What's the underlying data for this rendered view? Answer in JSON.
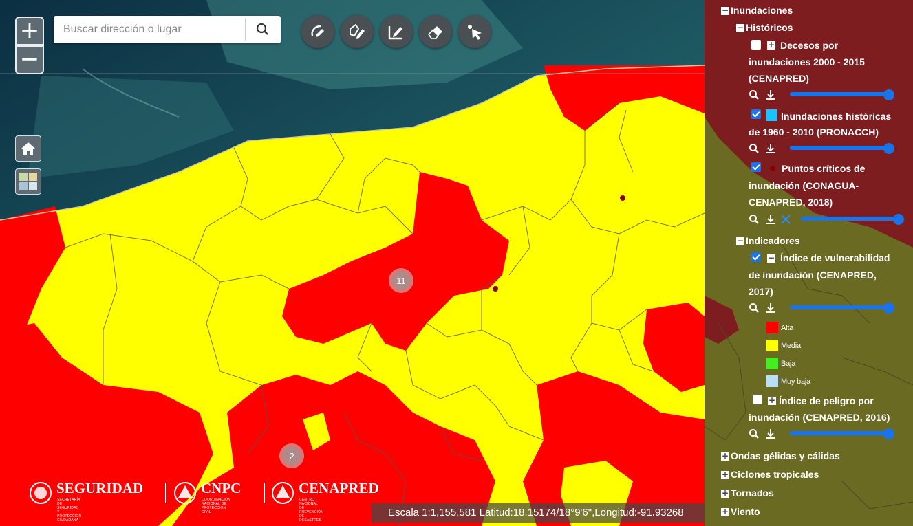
{
  "search": {
    "placeholder": "Buscar dirección o lugar"
  },
  "zoom": {
    "in": "+",
    "out": "−"
  },
  "toolbar": {
    "tools": [
      {
        "name": "draw-line-icon"
      },
      {
        "name": "draw-polygon-icon"
      },
      {
        "name": "edit-icon"
      },
      {
        "name": "eraser-icon"
      },
      {
        "name": "select-cursor-icon"
      }
    ]
  },
  "map": {
    "clusters": [
      {
        "count": "11"
      },
      {
        "count": "2"
      }
    ],
    "colors": {
      "alta": "#ff0000",
      "media": "#ffff00",
      "sea": "#143c4f",
      "boundary": "#555555"
    }
  },
  "logos": {
    "seguridad": "SEGURIDAD",
    "seguridad_sub": "SECRETARÍA DE SEGURIDAD Y PROTECCIÓN CIUDADANA",
    "cnpc": "CNPC",
    "cnpc_sub": "COORDINACIÓN NACIONAL DE PROTECCIÓN CIVIL",
    "cenapred": "CENAPRED",
    "cenapred_sub": "CENTRO NACIONAL DE PREVENCIÓN DE DESASTRES"
  },
  "status": {
    "text": "Escala 1:1,155,581 Latitud:18.15174/18°9'6\",Longitud:-91.93268"
  },
  "panel": {
    "inundaciones": "Inundaciones",
    "historicos": "Históricos",
    "decesos": [
      "Decesos por",
      "inundaciones 2000 - 2015",
      "(CENAPRED)"
    ],
    "historicas": [
      "Inundaciones históricas",
      "de 1960 - 2010 (PRONACCH)"
    ],
    "puntos": [
      "Puntos críticos de",
      "inundación (CONAGUA-",
      "CENAPRED, 2018)"
    ],
    "indicadores": "Indicadores",
    "vulnerabilidad": [
      "Índice de vulnerabilidad",
      "de inundación (CENAPRED,",
      "2017)"
    ],
    "legend": [
      {
        "label": "Alta",
        "color": "#ff0000"
      },
      {
        "label": "Media",
        "color": "#ffff00"
      },
      {
        "label": "Baja",
        "color": "#44ee22"
      },
      {
        "label": "Muy baja",
        "color": "#b8e0f4"
      }
    ],
    "peligro": [
      "Índice de peligro por",
      "inundación (CENAPRED, 2016)"
    ],
    "groups": [
      "Ondas gélidas y cálidas",
      "Ciclones tropicales",
      "Tornados",
      "Viento"
    ],
    "layer_colors": {
      "historicas": "#19c3ff",
      "puntos": "#8b0000"
    }
  }
}
